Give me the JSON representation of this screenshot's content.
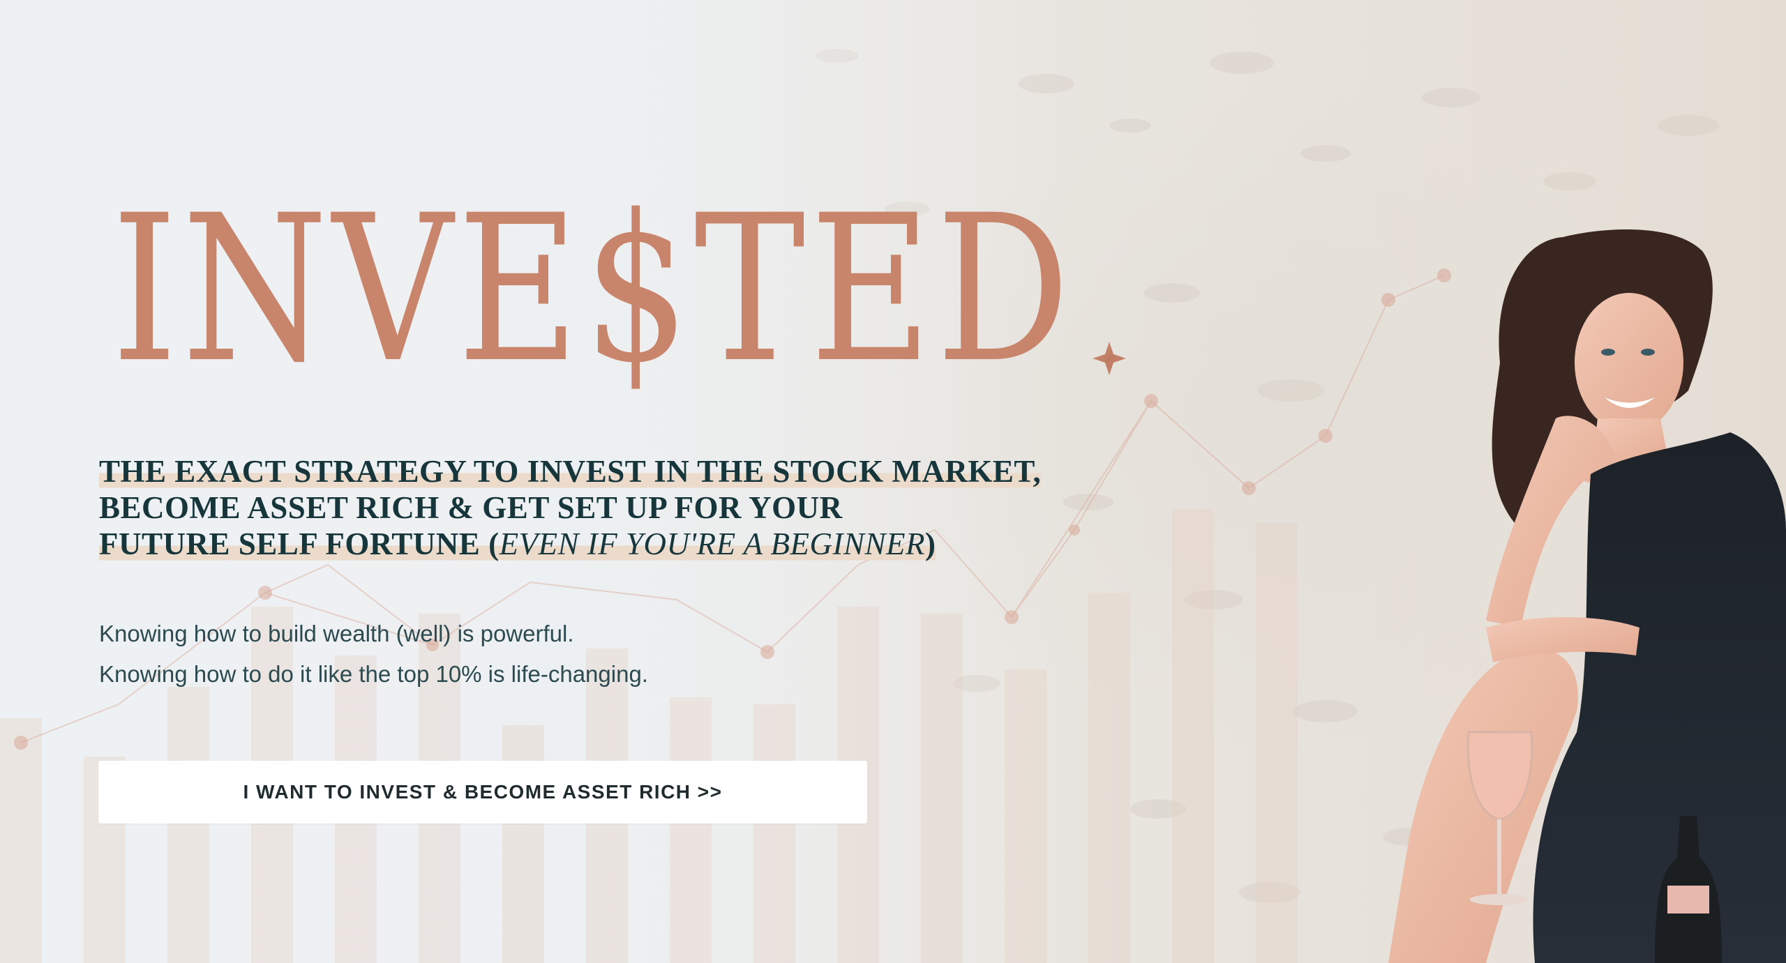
{
  "brand": {
    "logo_text": "INVE$TED",
    "accent_color": "#c9846c",
    "text_color": "#17363b"
  },
  "headline": {
    "line1": "THE EXACT STRATEGY TO INVEST IN THE STOCK MARKET,",
    "line2": "BECOME ASSET RICH & GET SET UP FOR YOUR",
    "line3_prefix": "FUTURE SELF FORTUNE (",
    "line3_italic": "EVEN IF YOU'RE A BEGINNER",
    "line3_suffix": ")"
  },
  "body": {
    "line1": "Knowing how to build wealth (well) is powerful.",
    "line2": "Knowing how to do it like the top 10% is life-changing."
  },
  "cta": {
    "label": "I WANT TO INVEST & BECOME ASSET RICH >>"
  }
}
